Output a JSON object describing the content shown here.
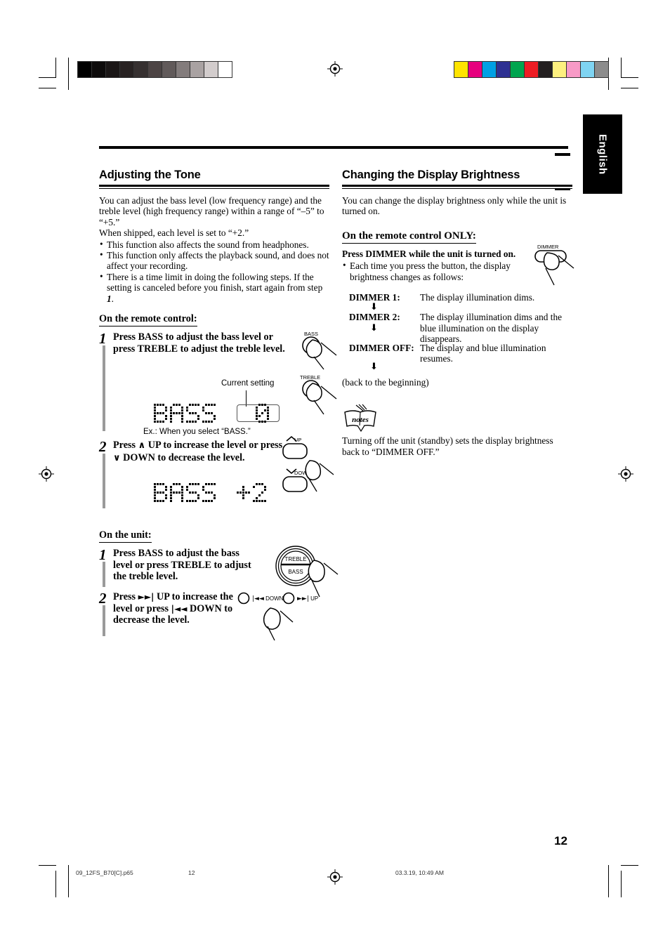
{
  "page": {
    "language_tab": "English",
    "page_number": "12",
    "footer": {
      "filename": "09_12FS_B70[C].p65",
      "page": "12",
      "timestamp": "03.3.19, 10:49 AM"
    },
    "grayscale_swatches": [
      "#000000",
      "#0d0b0b",
      "#1a1616",
      "#282222",
      "#363030",
      "#4c4444",
      "#615a5a",
      "#837c7c",
      "#a9a2a2",
      "#d2cccc",
      "#ffffff"
    ],
    "color_swatches": [
      "#ffe400",
      "#e6007e",
      "#00a0e4",
      "#2e3192",
      "#00a54f",
      "#ed1c24",
      "#231f20",
      "#fdf07f",
      "#f79ac6",
      "#7fd4f2",
      "#8c8c8c"
    ]
  },
  "left_column": {
    "heading": "Adjusting the Tone",
    "intro_1": "You can adjust the bass level (low frequency range) and the treble level (high frequency range) within a range of “–5” to “+5.”",
    "intro_2": "When shipped, each level is set to “+2.”",
    "bullets": [
      "This function also affects the sound from headphones.",
      "This function only affects the playback sound, and does not affect your recording.",
      "There is a time limit in doing the following steps. If the setting is canceled before you finish, start again from step "
    ],
    "bullet_3_step_ref": "1",
    "bullet_3_tail": ".",
    "remote_subhead": "On the remote control:",
    "remote_step_1": {
      "num": "1",
      "text": "Press BASS to adjust the bass level or press TREBLE to adjust the treble level.",
      "button_top_label": "BASS",
      "button_bottom_label": "TREBLE",
      "current_setting_caption": "Current setting",
      "lcd_text": "BASS",
      "lcd_value": "0",
      "example_caption": "Ex.: When you select “BASS.”"
    },
    "remote_step_2": {
      "num": "2",
      "text_part_1": "Press",
      "text_up": "UP to increase the level or",
      "text_part_2": "press",
      "text_down": "DOWN to decrease the level.",
      "button_up_label": "UP",
      "button_down_label": "DOWN",
      "lcd_text": "BASS",
      "lcd_value": "+2"
    },
    "unit_subhead": "On the unit:",
    "unit_step_1": {
      "num": "1",
      "text": "Press BASS to adjust the bass level or press TREBLE to adjust the treble level.",
      "knob_top_label": "TREBLE",
      "knob_bottom_label": "BASS"
    },
    "unit_step_2": {
      "num": "2",
      "text_part_1": "Press",
      "text_up": "UP to increase the",
      "text_part_2": "level or press",
      "text_down": "DOWN to decrease the level.",
      "down_button_label": "DOWN",
      "up_button_label": "UP"
    }
  },
  "right_column": {
    "heading": "Changing the Display Brightness",
    "intro": "You can change the display brightness only while the unit is turned on.",
    "remote_only_subhead": "On the remote control ONLY:",
    "press_dimmer": "Press DIMMER while the unit is turned on.",
    "dimmer_bullet": "Each time you press the button, the display brightness changes as follows:",
    "dimmer_button_label": "DIMMER",
    "dimmer_steps": [
      {
        "label": "DIMMER 1:",
        "description": "The display illumination dims."
      },
      {
        "label": "DIMMER 2:",
        "description": "The display illumination dims and the blue illumination on the display disappears."
      },
      {
        "label": "DIMMER OFF:",
        "description": "The display and blue illumination resumes."
      }
    ],
    "loop_note": "(back to the beginning)",
    "notes_icon_label": "notes",
    "notes_text": "Turning off the unit (standby) sets the display brightness back to “DIMMER OFF.”"
  }
}
